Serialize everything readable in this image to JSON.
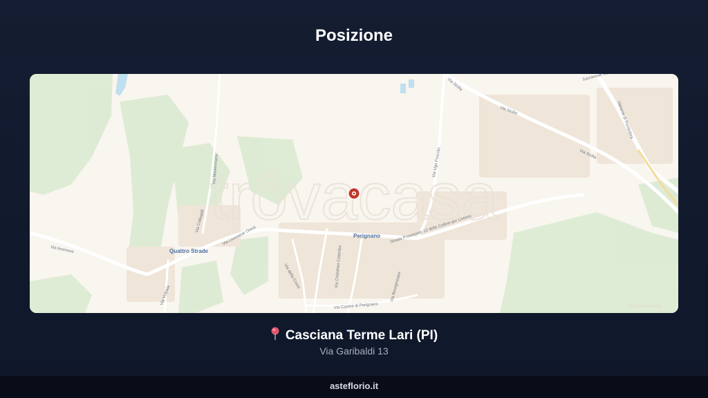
{
  "header": {
    "title": "Posizione"
  },
  "map": {
    "watermark": "trôvacasa",
    "attribution": "© OpenStreetMap",
    "labels": {
      "quattro_strade": "Quattro Strade",
      "perignano": "Perignano",
      "via_livornese": "Via livornese",
      "via_livornese_ovest": "Via Livornese Ovest",
      "strada_provinciale": "Strada Provinciale 12 delle Colline per Livorno",
      "via_sicilia_1": "Via Sicilia",
      "via_sicilia_2": "Via Sicilia",
      "via_sicilia_3": "Via Sicilia",
      "via_della_croce": "Via della Croce",
      "via_volpaia": "Via Volpaia",
      "via_casine_di_perignano": "Via Casine di Perignano",
      "via_bourgmestre": "Via Bourgmestre",
      "via_ugo_foscolo": "Via Ugo Foscolo",
      "via_maremmana": "Via Maremmana",
      "via_sarzanese": "Sarzanese Valdera",
      "variante_pontedera": "Variante di Pontedera",
      "via_colombo": "Via Cristoforo Colombo",
      "via_collegalli": "Via Collegalli"
    },
    "marker_color": "#c0392b"
  },
  "location": {
    "icon": "pin-icon",
    "name": "Casciana Terme Lari (PI)",
    "address": "Via Garibaldi 13"
  },
  "footer": {
    "site": "asteflorio.it"
  }
}
